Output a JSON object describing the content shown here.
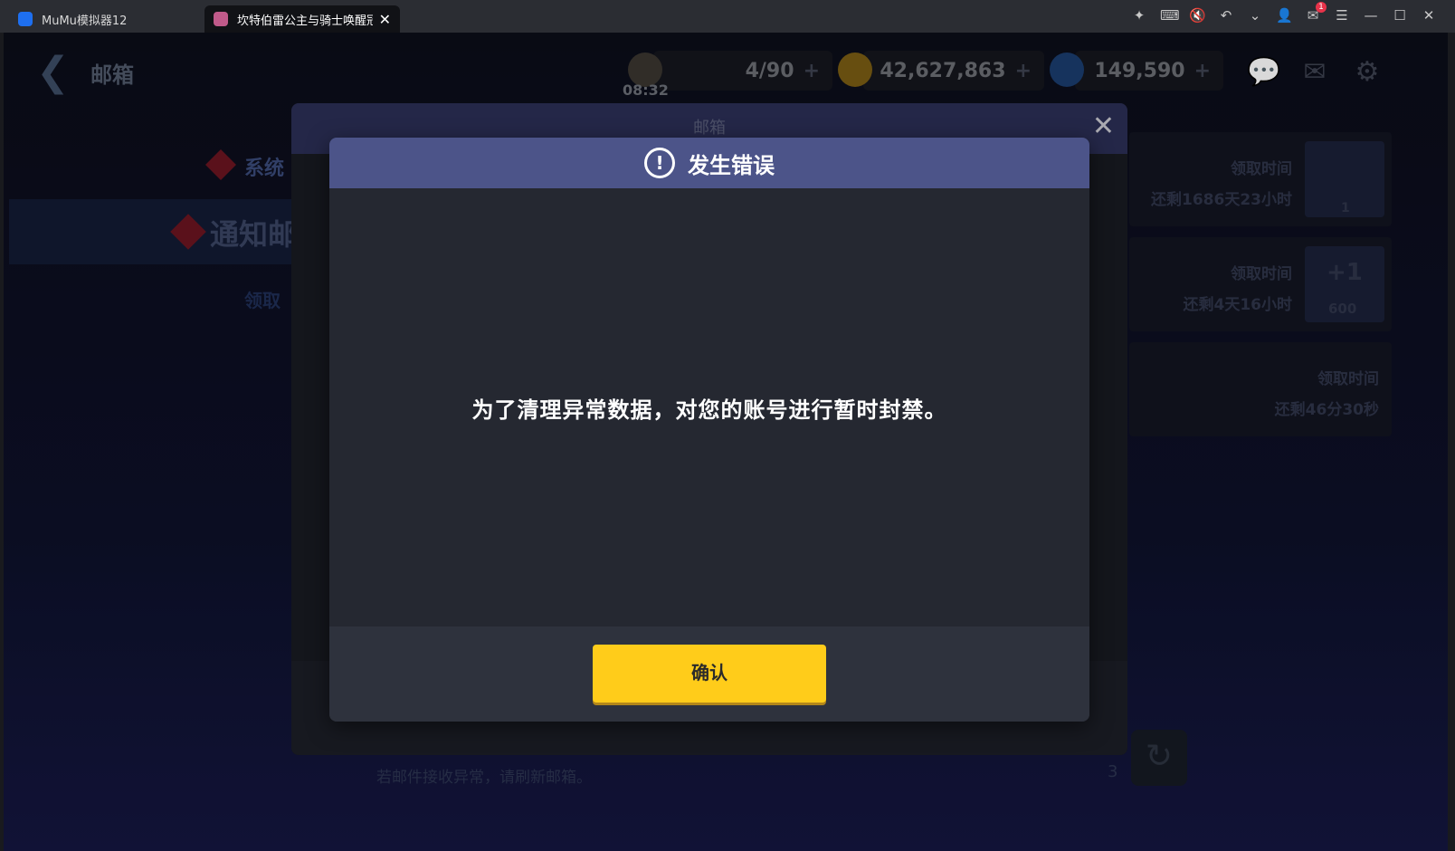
{
  "titlebar": {
    "tab1_label": "MuMu模拟器12",
    "tab2_label": "坎特伯雷公主与骑士唤醒冠军",
    "mail_badge": "1"
  },
  "game": {
    "header_title": "邮箱",
    "stamina": "4/90",
    "timer": "08:32",
    "gold": "42,627,863",
    "gems": "149,590"
  },
  "sidebar": {
    "item1": "系统",
    "item2": "通知邮",
    "item3": "领取"
  },
  "mail": {
    "title": "邮箱",
    "items": [
      {
        "label": "领取时间",
        "remaining": "还剩1686天23小时",
        "count": "1"
      },
      {
        "label": "领取时间",
        "remaining": "还剩4天16小时",
        "reward": "+1",
        "count": "600"
      },
      {
        "label": "领取时间",
        "remaining": "还剩46分30秒"
      }
    ],
    "footer_note": "若邮件接收异常，请刷新邮箱。",
    "footer_num": "3"
  },
  "dialog": {
    "title": "发生错误",
    "message": "为了清理异常数据，对您的账号进行暂时封禁。",
    "confirm": "确认"
  }
}
